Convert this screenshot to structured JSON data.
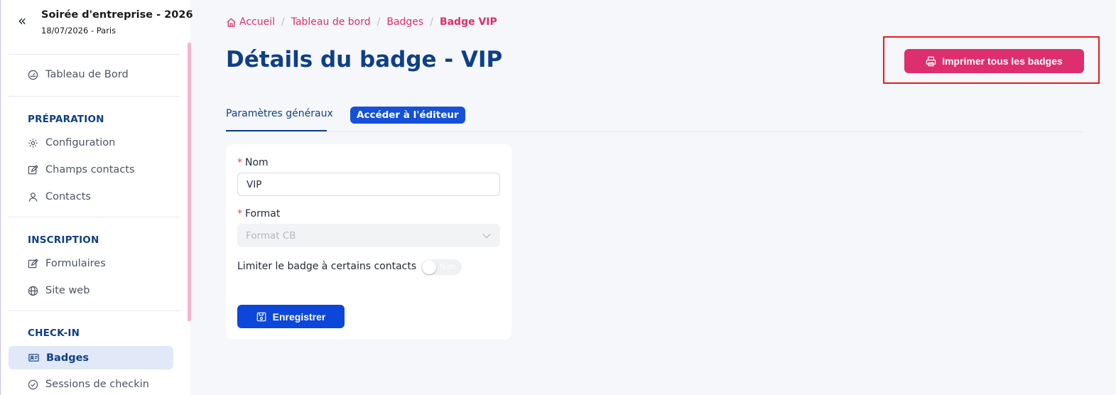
{
  "event": {
    "title": "Soirée d'entreprise - 2026",
    "subtitle": "18/07/2026 - Paris",
    "collapse_glyph": "«"
  },
  "sidebar": {
    "dashboard": {
      "label": "Tableau de Bord",
      "icon": "gauge-icon"
    },
    "sections": [
      {
        "title": "PRÉPARATION",
        "items": [
          {
            "label": "Configuration",
            "icon": "gear-icon"
          },
          {
            "label": "Champs contacts",
            "icon": "edit-icon"
          },
          {
            "label": "Contacts",
            "icon": "user-icon"
          }
        ]
      },
      {
        "title": "INSCRIPTION",
        "items": [
          {
            "label": "Formulaires",
            "icon": "edit-icon"
          },
          {
            "label": "Site web",
            "icon": "globe-icon"
          }
        ]
      },
      {
        "title": "CHECK-IN",
        "items": [
          {
            "label": "Badges",
            "icon": "badge-icon",
            "active": true
          },
          {
            "label": "Sessions de checkin",
            "icon": "check-circle-icon"
          }
        ]
      }
    ]
  },
  "breadcrumb": {
    "items": [
      "Accueil",
      "Tableau de bord",
      "Badges",
      "Badge VIP"
    ],
    "separator": "/"
  },
  "page": {
    "title": "Détails du badge - VIP",
    "print_all_label": "Imprimer tous les badges"
  },
  "tabs": {
    "general": "Paramètres généraux",
    "editor": "Accéder à l'éditeur"
  },
  "form": {
    "name_label": "Nom",
    "name_value": "VIP",
    "format_label": "Format",
    "format_value": "Format CB",
    "limit_label": "Limiter le badge à certains contacts",
    "limit_toggle_text": "Non",
    "required_mark": "*",
    "save_label": "Enregistrer"
  },
  "colors": {
    "brand_navy": "#0f3f86",
    "brand_pink": "#dd2e6e",
    "brand_blue": "#0d47d9",
    "highlight_red": "#ea1b1b"
  }
}
